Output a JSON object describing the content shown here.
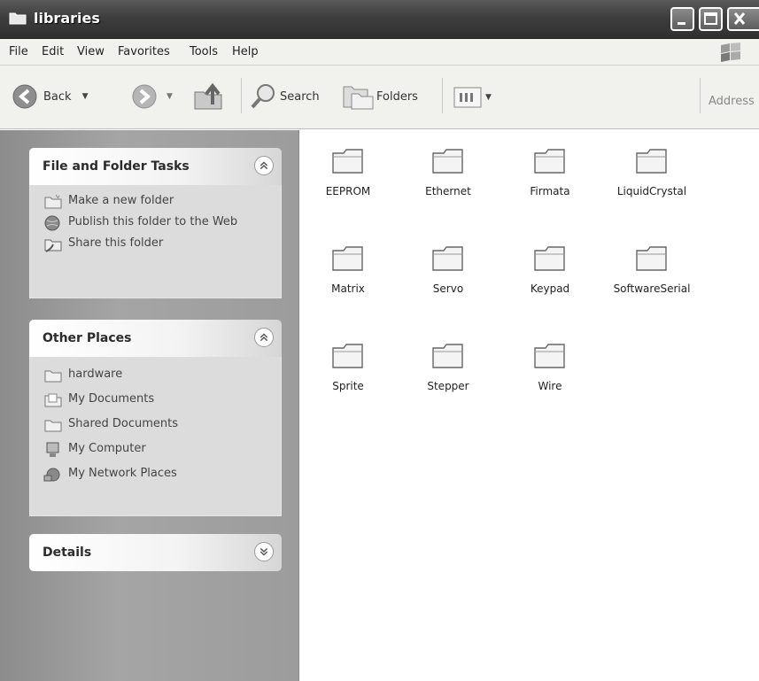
{
  "window": {
    "title": "libraries"
  },
  "menu": [
    "File",
    "Edit",
    "View",
    "Favorites",
    "Tools",
    "Help"
  ],
  "toolbar": {
    "back": "Back",
    "search": "Search",
    "folders": "Folders",
    "address": "Address"
  },
  "panels": {
    "file_tasks": {
      "title": "File and Folder Tasks",
      "items": [
        "Make a new folder",
        "Publish this folder to the Web",
        "Share this folder"
      ]
    },
    "other_places": {
      "title": "Other Places",
      "items": [
        "hardware",
        "My Documents",
        "Shared Documents",
        "My Computer",
        "My Network Places"
      ]
    },
    "details": {
      "title": "Details"
    }
  },
  "folders": [
    "EEPROM",
    "Ethernet",
    "Firmata",
    "LiquidCrystal",
    "Matrix",
    "Servo",
    "Keypad",
    "SoftwareSerial",
    "Sprite",
    "Stepper",
    "Wire"
  ]
}
